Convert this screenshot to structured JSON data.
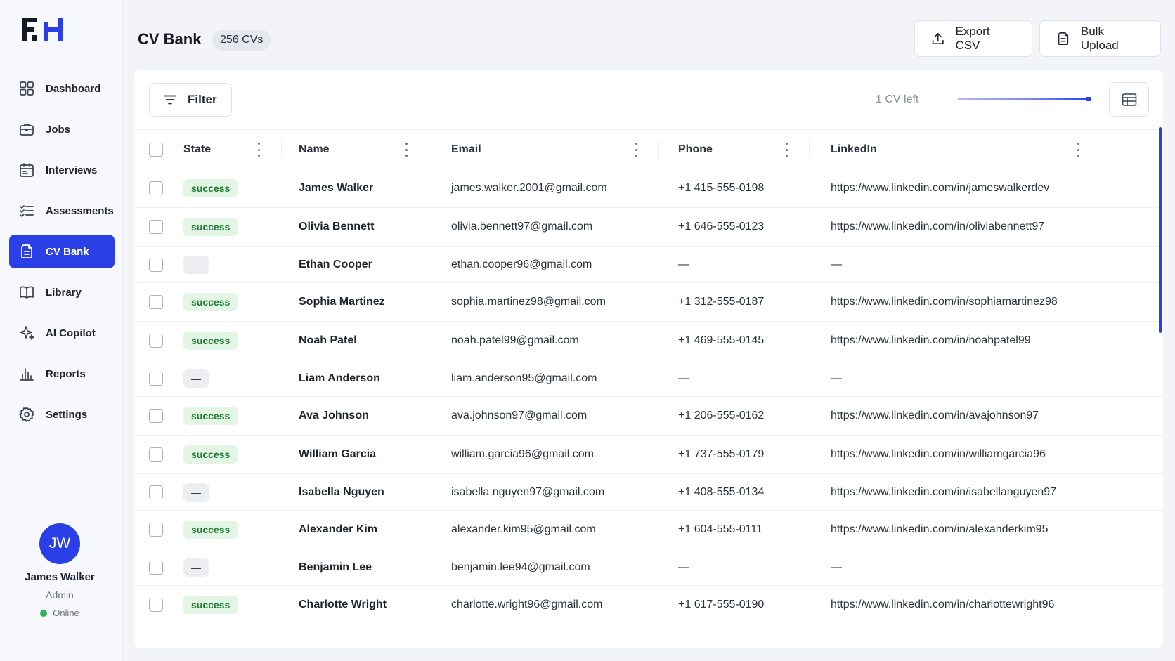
{
  "sidebar": {
    "logo_text": "FH",
    "items": [
      {
        "label": "Dashboard",
        "icon": "dashboard-grid-icon",
        "active": false
      },
      {
        "label": "Jobs",
        "icon": "briefcase-icon",
        "active": false
      },
      {
        "label": "Interviews",
        "icon": "calendar-icon",
        "active": false
      },
      {
        "label": "Assessments",
        "icon": "checklist-icon",
        "active": false
      },
      {
        "label": "CV Bank",
        "icon": "document-icon",
        "active": true
      },
      {
        "label": "Library",
        "icon": "book-icon",
        "active": false
      },
      {
        "label": "AI Copilot",
        "icon": "sparkle-icon",
        "active": false
      },
      {
        "label": "Reports",
        "icon": "bar-chart-icon",
        "active": false
      },
      {
        "label": "Settings",
        "icon": "gear-icon",
        "active": false
      }
    ],
    "user": {
      "initials": "JW",
      "name": "James Walker",
      "role": "Admin",
      "status": "Online",
      "status_color": "#2fb35a"
    }
  },
  "header": {
    "title": "CV Bank",
    "count": "256 CVs",
    "export_label": "Export CSV",
    "bulk_label": "Bulk Upload"
  },
  "toolbar": {
    "filter_label": "Filter",
    "cv_left": "1 CV left",
    "usage_fraction": 0.99
  },
  "table": {
    "columns": [
      "State",
      "Name",
      "Email",
      "Phone",
      "LinkedIn"
    ],
    "rows": [
      {
        "state": "success",
        "name": "James Walker",
        "email": "james.walker.2001@gmail.com",
        "phone": "+1 415-555-0198",
        "linkedin": "https://www.linkedin.com/in/jameswalkerdev"
      },
      {
        "state": "success",
        "name": "Olivia Bennett",
        "email": "olivia.bennett97@gmail.com",
        "phone": "+1 646-555-0123",
        "linkedin": "https://www.linkedin.com/in/oliviabennett97"
      },
      {
        "state": "—",
        "name": "Ethan Cooper",
        "email": "ethan.cooper96@gmail.com",
        "phone": "—",
        "linkedin": "—"
      },
      {
        "state": "success",
        "name": "Sophia Martinez",
        "email": "sophia.martinez98@gmail.com",
        "phone": "+1 312-555-0187",
        "linkedin": "https://www.linkedin.com/in/sophiamartinez98"
      },
      {
        "state": "success",
        "name": "Noah Patel",
        "email": "noah.patel99@gmail.com",
        "phone": "+1 469-555-0145",
        "linkedin": "https://www.linkedin.com/in/noahpatel99"
      },
      {
        "state": "—",
        "name": "Liam Anderson",
        "email": "liam.anderson95@gmail.com",
        "phone": "—",
        "linkedin": "—"
      },
      {
        "state": "success",
        "name": "Ava Johnson",
        "email": "ava.johnson97@gmail.com",
        "phone": "+1 206-555-0162",
        "linkedin": "https://www.linkedin.com/in/avajohnson97"
      },
      {
        "state": "success",
        "name": "William Garcia",
        "email": "william.garcia96@gmail.com",
        "phone": "+1 737-555-0179",
        "linkedin": "https://www.linkedin.com/in/williamgarcia96"
      },
      {
        "state": "—",
        "name": "Isabella Nguyen",
        "email": "isabella.nguyen97@gmail.com",
        "phone": "+1 408-555-0134",
        "linkedin": "https://www.linkedin.com/in/isabellanguyen97"
      },
      {
        "state": "success",
        "name": "Alexander Kim",
        "email": "alexander.kim95@gmail.com",
        "phone": "+1 604-555-0111",
        "linkedin": "https://www.linkedin.com/in/alexanderkim95"
      },
      {
        "state": "—",
        "name": "Benjamin Lee",
        "email": "benjamin.lee94@gmail.com",
        "phone": "—",
        "linkedin": "—"
      },
      {
        "state": "success",
        "name": "Charlotte Wright",
        "email": "charlotte.wright96@gmail.com",
        "phone": "+1 617-555-0190",
        "linkedin": "https://www.linkedin.com/in/charlottewright96"
      }
    ]
  },
  "colors": {
    "accent": "#2a3fe6",
    "success_bg": "#e3f6e6",
    "success_text": "#1e7c32"
  }
}
